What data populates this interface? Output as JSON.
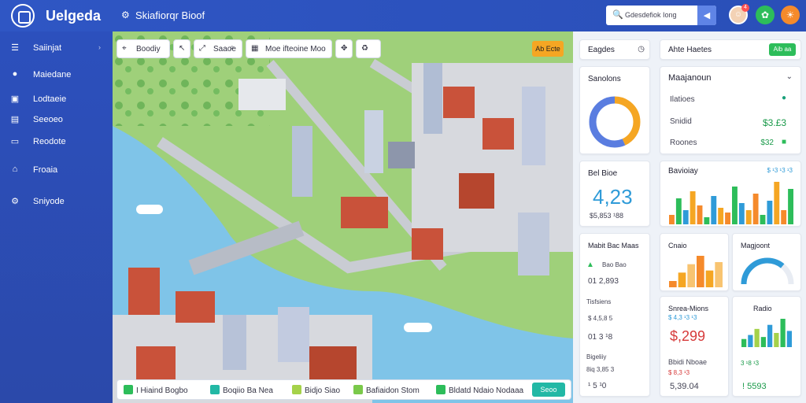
{
  "header": {
    "brand": "Uelgeda",
    "title": "Skiafiorqr Bioof",
    "search_placeholder": "Gdesdefiok Iong",
    "avatar_badge": "4"
  },
  "colors": {
    "primary": "#2f56c4",
    "accent": "#f5a623",
    "green": "#2dbd5a",
    "teal": "#22b8a5",
    "orange": "#f58a2b",
    "water": "#7fc4e8",
    "grass": "#9fd07a"
  },
  "sidebar": {
    "items": [
      {
        "icon": "list-icon",
        "label": "Saiinjat"
      },
      {
        "icon": "target-icon",
        "label": "Maiedane"
      },
      {
        "icon": "book-icon",
        "label": "Lodtaeie"
      },
      {
        "icon": "calendar-icon",
        "label": "Seeoeo"
      },
      {
        "icon": "window-icon",
        "label": "Reodote"
      },
      {
        "icon": "buildings-icon",
        "label": "Froaia"
      },
      {
        "icon": "gear-icon",
        "label": "Sniyode"
      }
    ]
  },
  "toolbar": {
    "items": [
      {
        "icon": "location-icon",
        "label": "Boodiy"
      },
      {
        "icon": "cursor-icon",
        "label": ""
      },
      {
        "icon": "zoom-icon",
        "label": "Saaoe"
      },
      {
        "icon": "search-icon",
        "label": ""
      },
      {
        "icon": "map-icon",
        "label": "Moe ifteoine Moo"
      },
      {
        "icon": "move-icon",
        "label": ""
      },
      {
        "icon": "recycle-icon",
        "label": ""
      }
    ],
    "action": "Ab Ecte"
  },
  "bottombar": {
    "items": [
      {
        "label": "I Hiaind Bogbo",
        "color": "#2dbd5a"
      },
      {
        "label": "Boqiio Ba Nea",
        "color": "#22b8a5"
      },
      {
        "label": "Bidjo Siao",
        "color": "#a5d24a"
      },
      {
        "label": "Bafiaidon Stom",
        "color": "#7ac94a"
      },
      {
        "label": "Bldatd Ndaio Nodaaa",
        "color": "#2dbd5a"
      }
    ],
    "action": "Seoo"
  },
  "panel_header": {
    "title": "Eagdes",
    "right_title": "Ahte Haetes",
    "right_btn": "Aib aa"
  },
  "donut": {
    "title": "Sanolons",
    "fraction": 0.72
  },
  "kpi": {
    "title": "Bel Bioe",
    "value": "4,23",
    "sub": "$5,853 ¹88"
  },
  "mini_list": {
    "title": "Mabit Bac Maas",
    "rows": [
      {
        "label": "Bao Bao",
        "value": "01 2,893"
      },
      {
        "label": "Tisfsiens",
        "value": "$ 4,5,8 5"
      },
      {
        "label": "",
        "value": "01 3 ¹8"
      },
      {
        "label": "Bigeliiy",
        "value": "8iq 3,85 3"
      },
      {
        "label": "",
        "value": "¹ 5 ¹0"
      }
    ]
  },
  "maintenance": {
    "title": "Maajanoun",
    "rows": [
      {
        "label": "Ilatioes",
        "value": ""
      },
      {
        "label": "Snidid",
        "value": "$3.£3"
      },
      {
        "label": "Roones",
        "value": "$32"
      }
    ]
  },
  "bar_card": {
    "title": "Bavioiay",
    "sub": "$ ¹3 ¹3 ¹3"
  },
  "chart_data": [
    {
      "type": "bar",
      "title": "Bavioiay",
      "values": [
        20,
        55,
        30,
        70,
        40,
        15,
        60,
        35,
        25,
        80,
        45,
        30,
        65,
        20,
        50,
        90,
        30,
        75
      ]
    },
    {
      "type": "bar",
      "title": "Cnaio",
      "values": [
        15,
        35,
        55,
        75,
        40,
        60
      ]
    },
    {
      "type": "pie",
      "title": "Magjoont",
      "values": [
        72,
        28
      ]
    },
    {
      "type": "bar",
      "title": "Radio",
      "values": [
        20,
        30,
        45,
        25,
        55,
        35,
        70,
        40
      ]
    }
  ],
  "stat_cards": [
    {
      "title": "Snrea-Mions",
      "sub": "$ 4,3 ¹3 ¹3",
      "value": "$,299"
    },
    {
      "title": "Bbidi Nboae",
      "sub": "$ 8,3 ¹3",
      "value": "5,39.04"
    },
    {
      "title": "",
      "sub": "3 ¹8 ¹3",
      "value": "! 5593"
    }
  ]
}
